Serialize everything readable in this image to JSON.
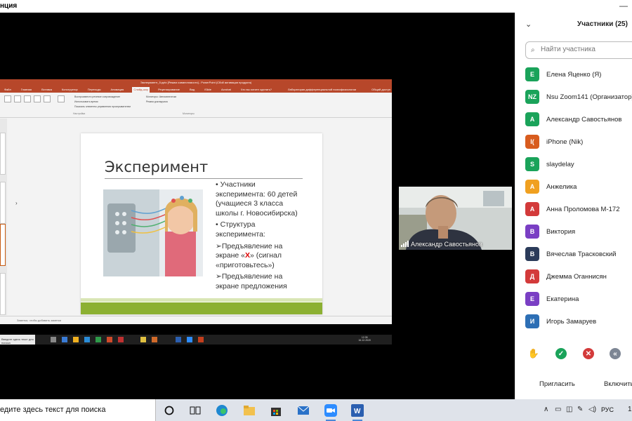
{
  "window": {
    "title": "нция",
    "minimize_glyph": "—"
  },
  "ppt": {
    "title_text": "Эксперимент_5.pptx [Режим совместимости] - PowerPoint (Сбой активации продукта)",
    "title_right": "Лаборатория дифференциальной психофизиологии",
    "tabs": [
      "Файл",
      "Главная",
      "Вставка",
      "Конструктор",
      "Переходы",
      "Анимация",
      "Слайд-шоу",
      "Рецензирование",
      "Вид",
      "iSlide",
      "Acrobat",
      "Что вы хотите сделать?"
    ],
    "active_tab": "Слайд-шоу",
    "share_label": "Общий доступ",
    "ribbon": {
      "col1": [
        "Воспроизвести речевое сопровождение",
        "Использовать время",
        "Показать элементы управления проигрывателем"
      ],
      "col2": [
        "Мониторы: Автоматически",
        "Режим докладчика"
      ],
      "group1": "Настройка",
      "group2": "Мониторы"
    },
    "notes_placeholder": "Заметки, чтобы добавить заметки",
    "slide": {
      "title": "Эксперимент",
      "bullets": [
        {
          "text": "Участники эксперимента: 60 детей (учащиеся 3 класса школы г. Новосибирска)",
          "marker": "•"
        },
        {
          "text": "Структура эксперимента:",
          "marker": "•"
        },
        {
          "pre": "Предъявление на экране «",
          "mark": "Х",
          "post": "» (сигнал «приготовьтесь»)",
          "marker": "➢"
        },
        {
          "text": "Предъявление на экране предложения",
          "marker": "➢"
        }
      ],
      "accent_color": "#8cb032"
    },
    "inner_taskbar": {
      "search": "Введите здесь текст для поиска",
      "time": "12:35",
      "date": "16.12.2020"
    }
  },
  "video": {
    "name": "Александр Савостьянов"
  },
  "panel": {
    "title": "Участники (25)",
    "search_placeholder": "Найти участника",
    "participants": [
      {
        "initials": "Е",
        "name": "Елена Яценко (Я)",
        "color": "#1aa35a"
      },
      {
        "initials": "NZ",
        "name": "Nsu Zoom141 (Организатор)",
        "color": "#1aa35a"
      },
      {
        "initials": "А",
        "name": "Александр Савостьянов",
        "color": "#1aa35a"
      },
      {
        "initials": "I(",
        "name": "iPhone (Nik)",
        "color": "#d85c1e"
      },
      {
        "initials": "S",
        "name": "slaydelay",
        "color": "#1aa35a"
      },
      {
        "initials": "А",
        "name": "Анжелика",
        "color": "#f0a020"
      },
      {
        "initials": "А",
        "name": "Анна Проломова М-172",
        "color": "#d33a3a"
      },
      {
        "initials": "В",
        "name": "Виктория",
        "color": "#7a3fc4"
      },
      {
        "initials": "В",
        "name": "Вячеслав Трасковский",
        "color": "#2b3b5a"
      },
      {
        "initials": "Д",
        "name": "Джемма Оганнисян",
        "color": "#d33a3a"
      },
      {
        "initials": "Е",
        "name": "Екатерина",
        "color": "#7a3fc4"
      },
      {
        "initials": "И",
        "name": "Игорь Замаруев",
        "color": "#2d6fb5"
      }
    ],
    "reactions": {
      "raise_hand": "✋",
      "yes": "✓",
      "no": "✕",
      "slower": "«"
    },
    "invite_label": "Пригласить",
    "unmute_label": "Включить"
  },
  "taskbar": {
    "search_text": "едите здесь текст для поиска",
    "language": "РУС",
    "clock_fragment": "1"
  }
}
